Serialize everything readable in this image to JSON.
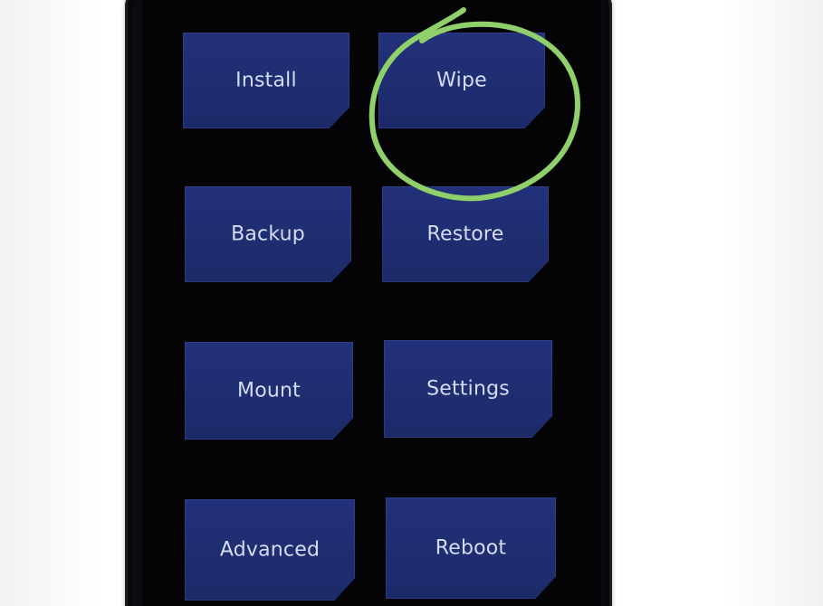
{
  "menu": {
    "items": [
      {
        "id": "install",
        "label": "Install"
      },
      {
        "id": "wipe",
        "label": "Wipe"
      },
      {
        "id": "backup",
        "label": "Backup"
      },
      {
        "id": "restore",
        "label": "Restore"
      },
      {
        "id": "mount",
        "label": "Mount"
      },
      {
        "id": "settings",
        "label": "Settings"
      },
      {
        "id": "advanced",
        "label": "Advanced"
      },
      {
        "id": "reboot",
        "label": "Reboot"
      }
    ]
  },
  "colors": {
    "tile": "#1f2d6e",
    "tile_text": "#d6dcf4",
    "highlight": "#8fd06a",
    "screen": "#040406"
  }
}
